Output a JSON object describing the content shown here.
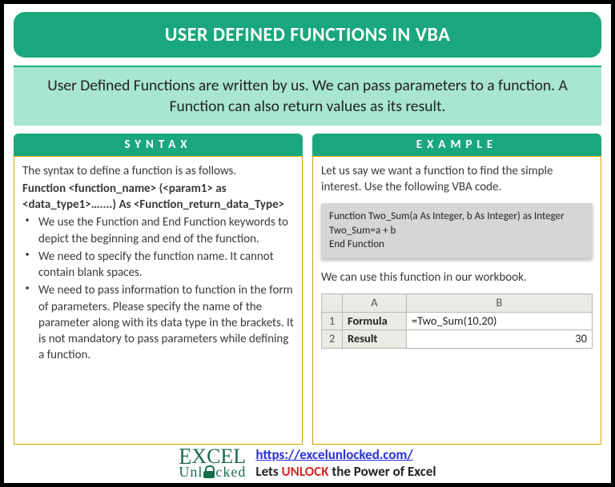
{
  "title": "USER DEFINED FUNCTIONS IN VBA",
  "subtitle": "User Defined Functions are written by us. We can pass parameters to a function. A Function can also return values as its result.",
  "syntax": {
    "header": "SYNTAX",
    "intro": "The syntax to define a function is as follows.",
    "boldLine1": "Function <function_name> (<param1> as <data_type1>…....) As <Function_return_data_Type>",
    "bullets": [
      "We use the Function and End Function keywords to depict the beginning and end of the function.",
      "We need to specify the function name. It cannot contain blank spaces.",
      "We need to pass information to function in the form of parameters. Please specify the name of the parameter along with its data type in the brackets. It is not mandatory to pass parameters while defining a function."
    ]
  },
  "example": {
    "header": "EXAMPLE",
    "intro": "Let us say we want a function to find the simple interest. Use the following VBA code.",
    "code": [
      "Function Two_Sum(a As Integer, b As Integer) as Integer",
      "Two_Sum=a + b",
      "End Function"
    ],
    "afterCode": "We can use this function in our workbook.",
    "table": {
      "colA": "A",
      "colB": "B",
      "r1": "1",
      "r2": "2",
      "a1": "Formula",
      "b1": "=Two_Sum(10,20)",
      "a2": "Result",
      "b2": "30"
    }
  },
  "footer": {
    "logoTop": "EXCEL",
    "logoBottomPre": "Unl",
    "logoBottomPost": "cked",
    "url": "https://excelunlocked.com/",
    "taglinePre": "Lets ",
    "taglineUnlock": "UNLOCK",
    "taglinePost": " the Power of Excel"
  }
}
